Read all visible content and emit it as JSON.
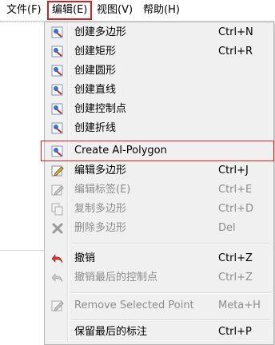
{
  "menubar": {
    "file": "文件(F)",
    "edit": "编辑(E)",
    "view": "视图(V)",
    "help": "帮助(H)"
  },
  "menu": {
    "items": [
      {
        "label": "创建多边形",
        "shortcut": "Ctrl+N",
        "icon": "polygon-icon",
        "enabled": true
      },
      {
        "label": "创建矩形",
        "shortcut": "Ctrl+R",
        "icon": "rectangle-icon",
        "enabled": true
      },
      {
        "label": "创建圆形",
        "shortcut": "",
        "icon": "circle-icon",
        "enabled": true
      },
      {
        "label": "创建直线",
        "shortcut": "",
        "icon": "line-icon",
        "enabled": true
      },
      {
        "label": "创建控制点",
        "shortcut": "",
        "icon": "point-icon",
        "enabled": true
      },
      {
        "label": "创建折线",
        "shortcut": "",
        "icon": "polyline-icon",
        "enabled": true
      },
      {
        "label": "Create AI-Polygon",
        "shortcut": "",
        "icon": "ai-polygon-icon",
        "enabled": true
      },
      {
        "label": "编辑多边形",
        "shortcut": "Ctrl+J",
        "icon": "edit-icon",
        "enabled": true
      },
      {
        "label": "编辑标签(E)",
        "shortcut": "Ctrl+E",
        "icon": "edit-label-icon",
        "enabled": false
      },
      {
        "label": "复制多边形",
        "shortcut": "Ctrl+D",
        "icon": "copy-icon",
        "enabled": false
      },
      {
        "label": "删除多边形",
        "shortcut": "Del",
        "icon": "delete-icon",
        "enabled": false
      },
      {
        "label": "撤销",
        "shortcut": "Ctrl+Z",
        "icon": "undo-icon",
        "enabled": true
      },
      {
        "label": "撤销最后的控制点",
        "shortcut": "Ctrl+Z",
        "icon": "undo-point-icon",
        "enabled": false
      },
      {
        "label": "Remove Selected Point",
        "shortcut": "Meta+H",
        "icon": "remove-point-icon",
        "enabled": false
      },
      {
        "label": "保留最后的标注",
        "shortcut": "Ctrl+P",
        "icon": "",
        "enabled": true
      }
    ]
  }
}
